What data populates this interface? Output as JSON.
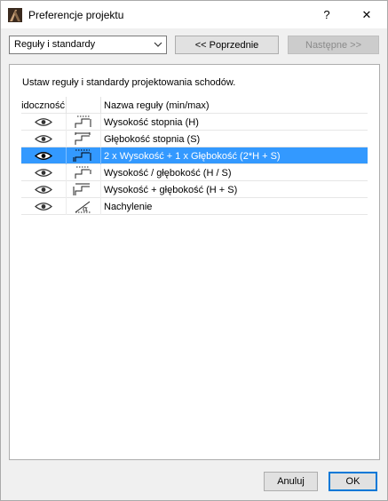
{
  "window": {
    "title": "Preferencje projektu",
    "help_label": "?",
    "close_label": "✕"
  },
  "toolbar": {
    "category_select": {
      "value": "Reguły i standardy"
    },
    "prev_label": "<< Poprzednie",
    "next_label": "Następne >>"
  },
  "panel": {
    "description": "Ustaw reguły i standardy projektowania schodów.",
    "columns": {
      "visibility": "Widoczność",
      "icon": "",
      "name": "Nazwa reguły (min/max)"
    },
    "rules": [
      {
        "name": "Wysokość stopnia (H)",
        "icon": "stair-height-icon",
        "selected": false
      },
      {
        "name": "Głębokość stopnia (S)",
        "icon": "stair-depth-icon",
        "selected": false
      },
      {
        "name": "2 x Wysokość + 1 x Głębokość (2*H + S)",
        "icon": "stair-formula-icon",
        "selected": true
      },
      {
        "name": "Wysokość / głębokość (H / S)",
        "icon": "stair-ratio-icon",
        "selected": false
      },
      {
        "name": "Wysokość + głębokość (H + S)",
        "icon": "stair-sum-icon",
        "selected": false
      },
      {
        "name": "Nachylenie",
        "icon": "slope-angle-icon",
        "selected": false
      }
    ]
  },
  "footer": {
    "cancel_label": "Anuluj",
    "ok_label": "OK"
  },
  "colors": {
    "selection": "#3399ff",
    "ok_border": "#0078d7"
  }
}
